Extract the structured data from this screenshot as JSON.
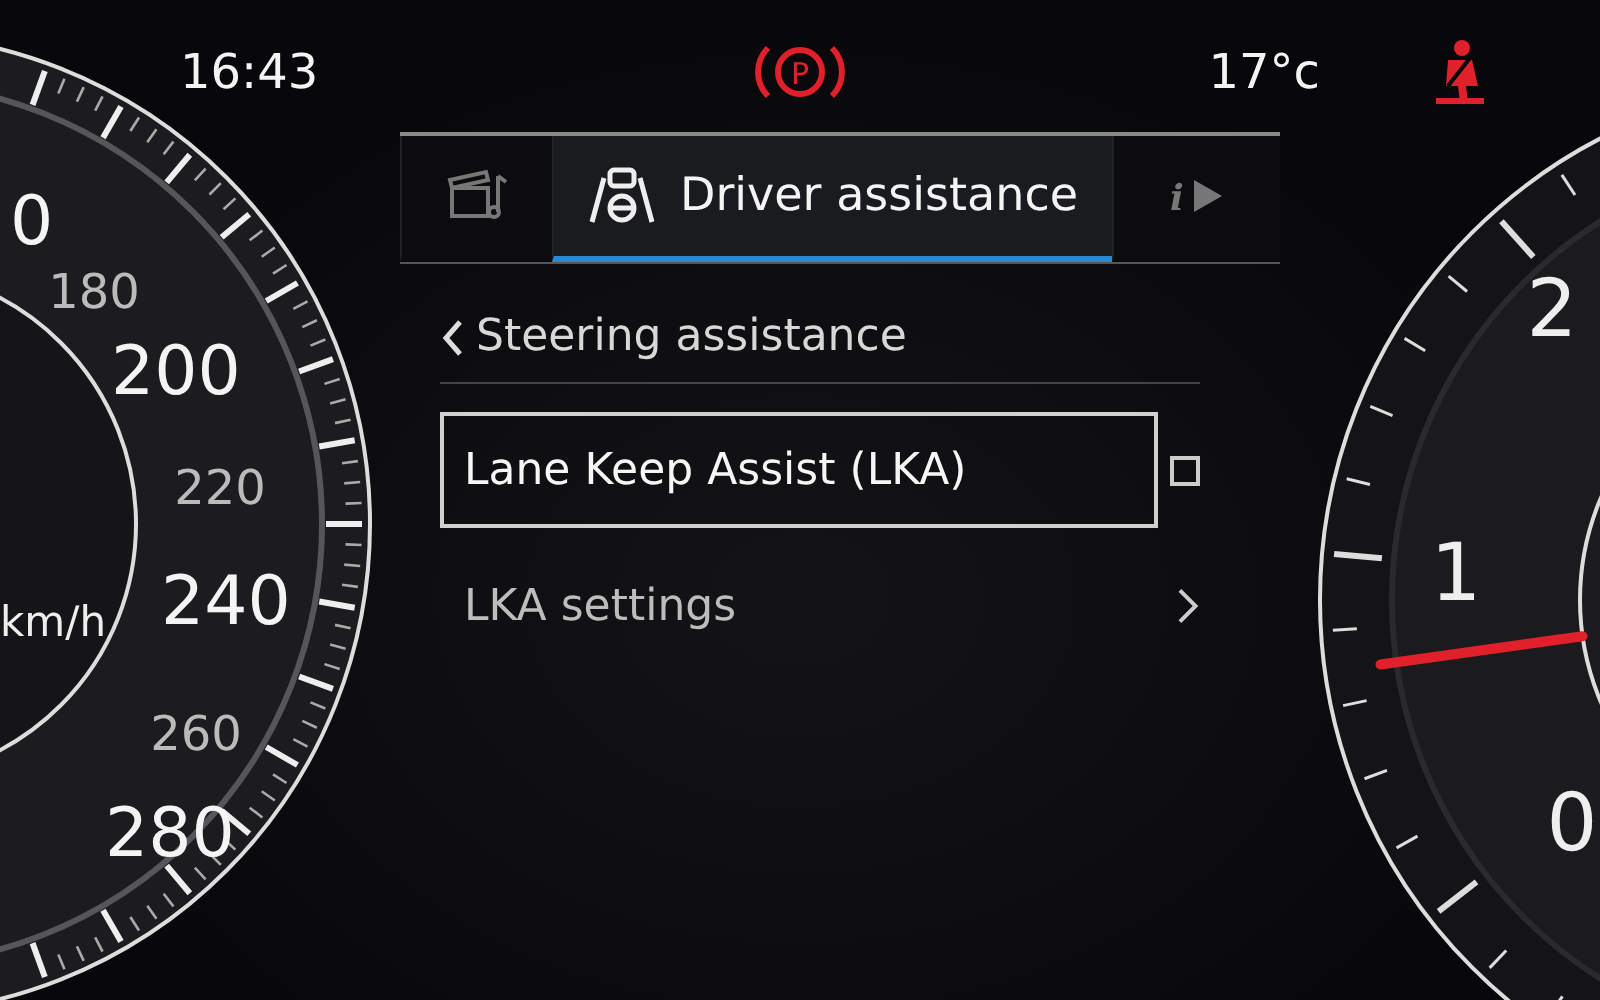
{
  "status_bar": {
    "time": "16:43",
    "parking_brake_warning": true,
    "parking_icon_letter": "P",
    "temperature": "17°c",
    "seatbelt_warning": true
  },
  "speedometer": {
    "unit": "km/h",
    "labels": [
      {
        "text": "0",
        "kind": "major"
      },
      {
        "text": "180",
        "kind": "minor"
      },
      {
        "text": "200",
        "kind": "major"
      },
      {
        "text": "220",
        "kind": "minor"
      },
      {
        "text": "240",
        "kind": "major"
      },
      {
        "text": "260",
        "kind": "minor"
      },
      {
        "text": "280",
        "kind": "major"
      }
    ]
  },
  "tabs": [
    {
      "kind": "media",
      "selected": false
    },
    {
      "kind": "driver",
      "label": "Driver assistance",
      "selected": true
    },
    {
      "kind": "info",
      "icon_letter": "i",
      "selected": false
    }
  ],
  "menu": {
    "back_label": "Steering assistance",
    "items": [
      {
        "kind": "checkbox",
        "label": "Lane Keep Assist (LKA)",
        "checked": false,
        "selected": true
      },
      {
        "kind": "submenu",
        "label": "LKA settings",
        "selected": false
      }
    ]
  },
  "tachometer": {
    "labels": [
      "2",
      "1",
      "0"
    ]
  }
}
